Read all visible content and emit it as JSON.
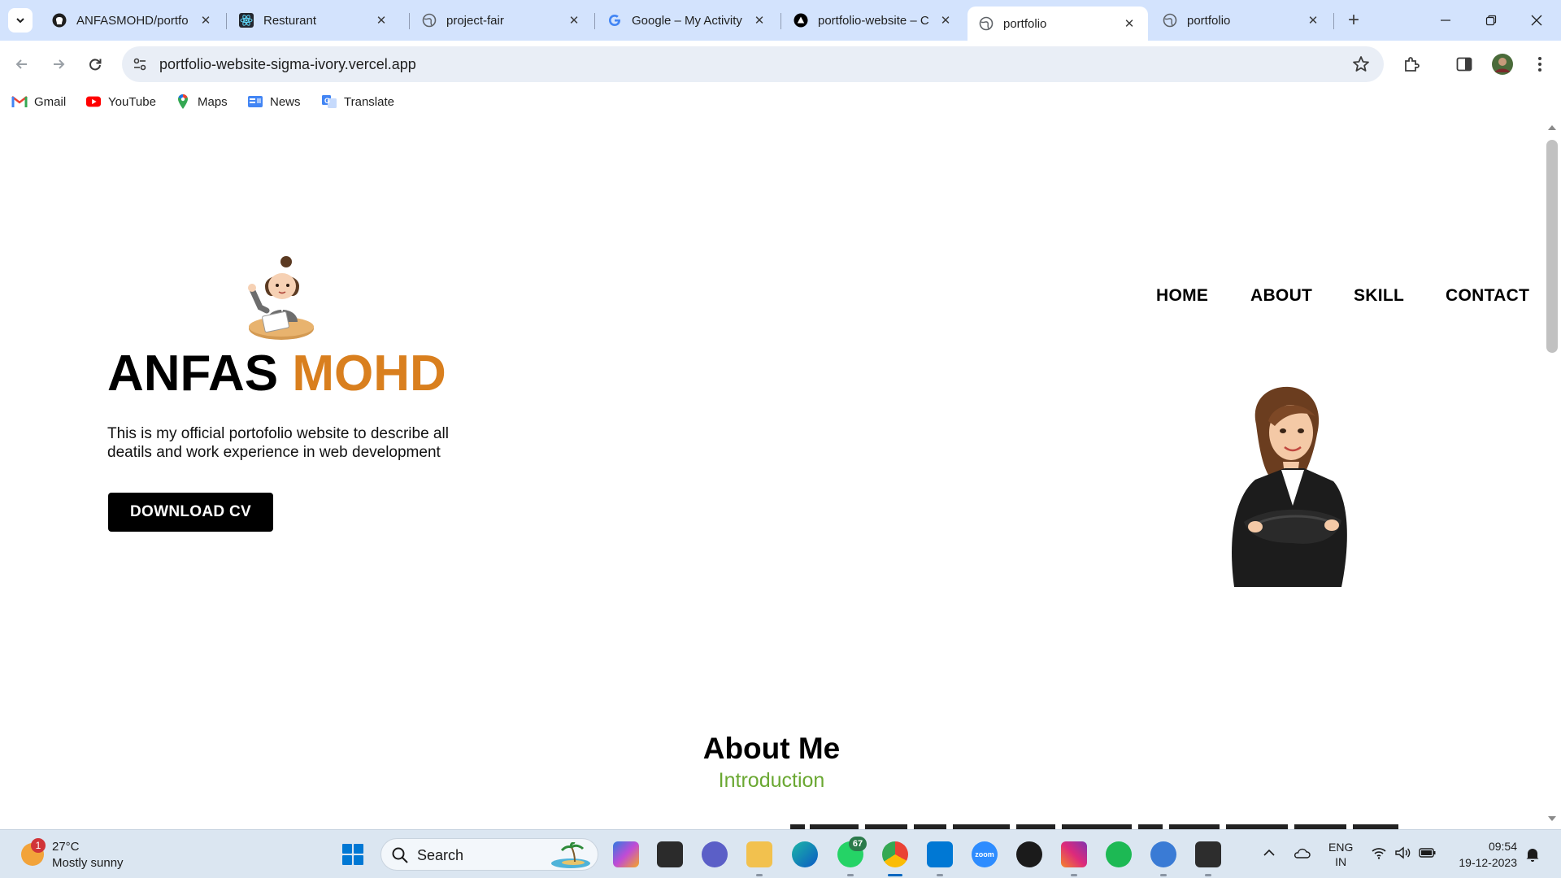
{
  "browser": {
    "tabs": [
      {
        "title": "ANFASMOHD/portfo",
        "icon": "github-icon"
      },
      {
        "title": "Resturant",
        "icon": "react-icon"
      },
      {
        "title": "project-fair",
        "icon": "globe-icon"
      },
      {
        "title": "Google – My Activity",
        "icon": "google-icon"
      },
      {
        "title": "portfolio-website – C",
        "icon": "vercel-icon"
      },
      {
        "title": "portfolio",
        "icon": "globe-icon",
        "active": true
      },
      {
        "title": "portfolio",
        "icon": "globe-icon"
      }
    ],
    "new_tab_label": "+",
    "address": "portfolio-website-sigma-ivory.vercel.app",
    "bookmarks": [
      {
        "label": "Gmail",
        "icon": "gmail-icon"
      },
      {
        "label": "YouTube",
        "icon": "youtube-icon"
      },
      {
        "label": "Maps",
        "icon": "maps-icon"
      },
      {
        "label": "News",
        "icon": "news-icon"
      },
      {
        "label": "Translate",
        "icon": "translate-icon"
      }
    ]
  },
  "page": {
    "nav": [
      "HOME",
      "ABOUT",
      "SKILL",
      "CONTACT"
    ],
    "hero": {
      "name_first": "ANFAS",
      "name_second": "MOHD",
      "description": "This is my official portofolio website to describe all deatils and work experience in web development",
      "cv_button": "DOWNLOAD CV"
    },
    "about": {
      "title": "About Me",
      "subtitle": "Introduction"
    },
    "colors": {
      "accent": "#d97f1e",
      "subtitle": "#6aa832",
      "button_bg": "#000000"
    }
  },
  "taskbar": {
    "weather": {
      "badge": "1",
      "temp": "27°C",
      "condition": "Mostly sunny"
    },
    "search_placeholder": "Search",
    "whatsapp_badge": "67",
    "zoom_label": "zoom",
    "language": {
      "line1": "ENG",
      "line2": "IN"
    },
    "time": "09:54",
    "date": "19-12-2023"
  }
}
